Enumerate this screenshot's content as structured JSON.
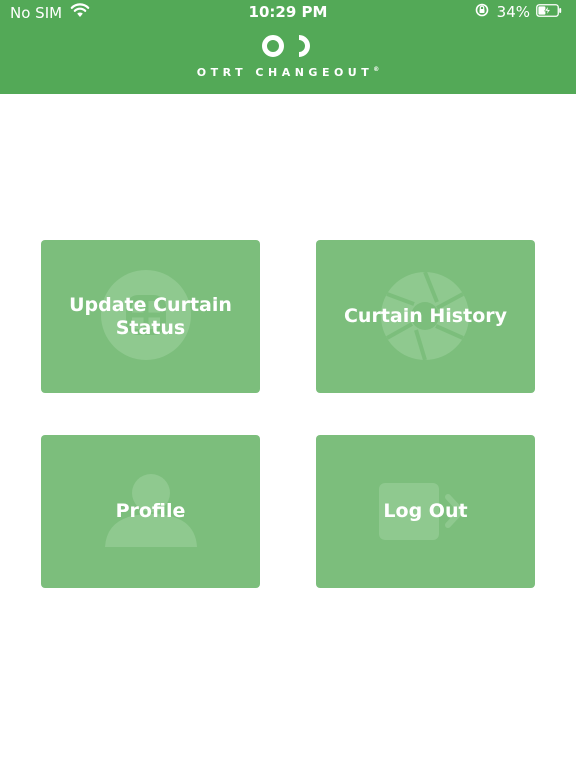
{
  "status_bar": {
    "carrier": "No SIM",
    "time": "10:29 PM",
    "battery": "34%"
  },
  "header": {
    "brand": "OTRT CHANGEOUT",
    "brand_mark": "®",
    "logo_icon": "otrt-logo-icon",
    "background": "#53a957"
  },
  "menu": {
    "tile_color": "#7cbe7c",
    "items": [
      {
        "label": "Update Curtain Status",
        "icon": "curtain-status-icon"
      },
      {
        "label": "Curtain History",
        "icon": "aperture-icon"
      },
      {
        "label": "Profile",
        "icon": "person-icon"
      },
      {
        "label": "Log Out",
        "icon": "logout-icon"
      }
    ]
  }
}
